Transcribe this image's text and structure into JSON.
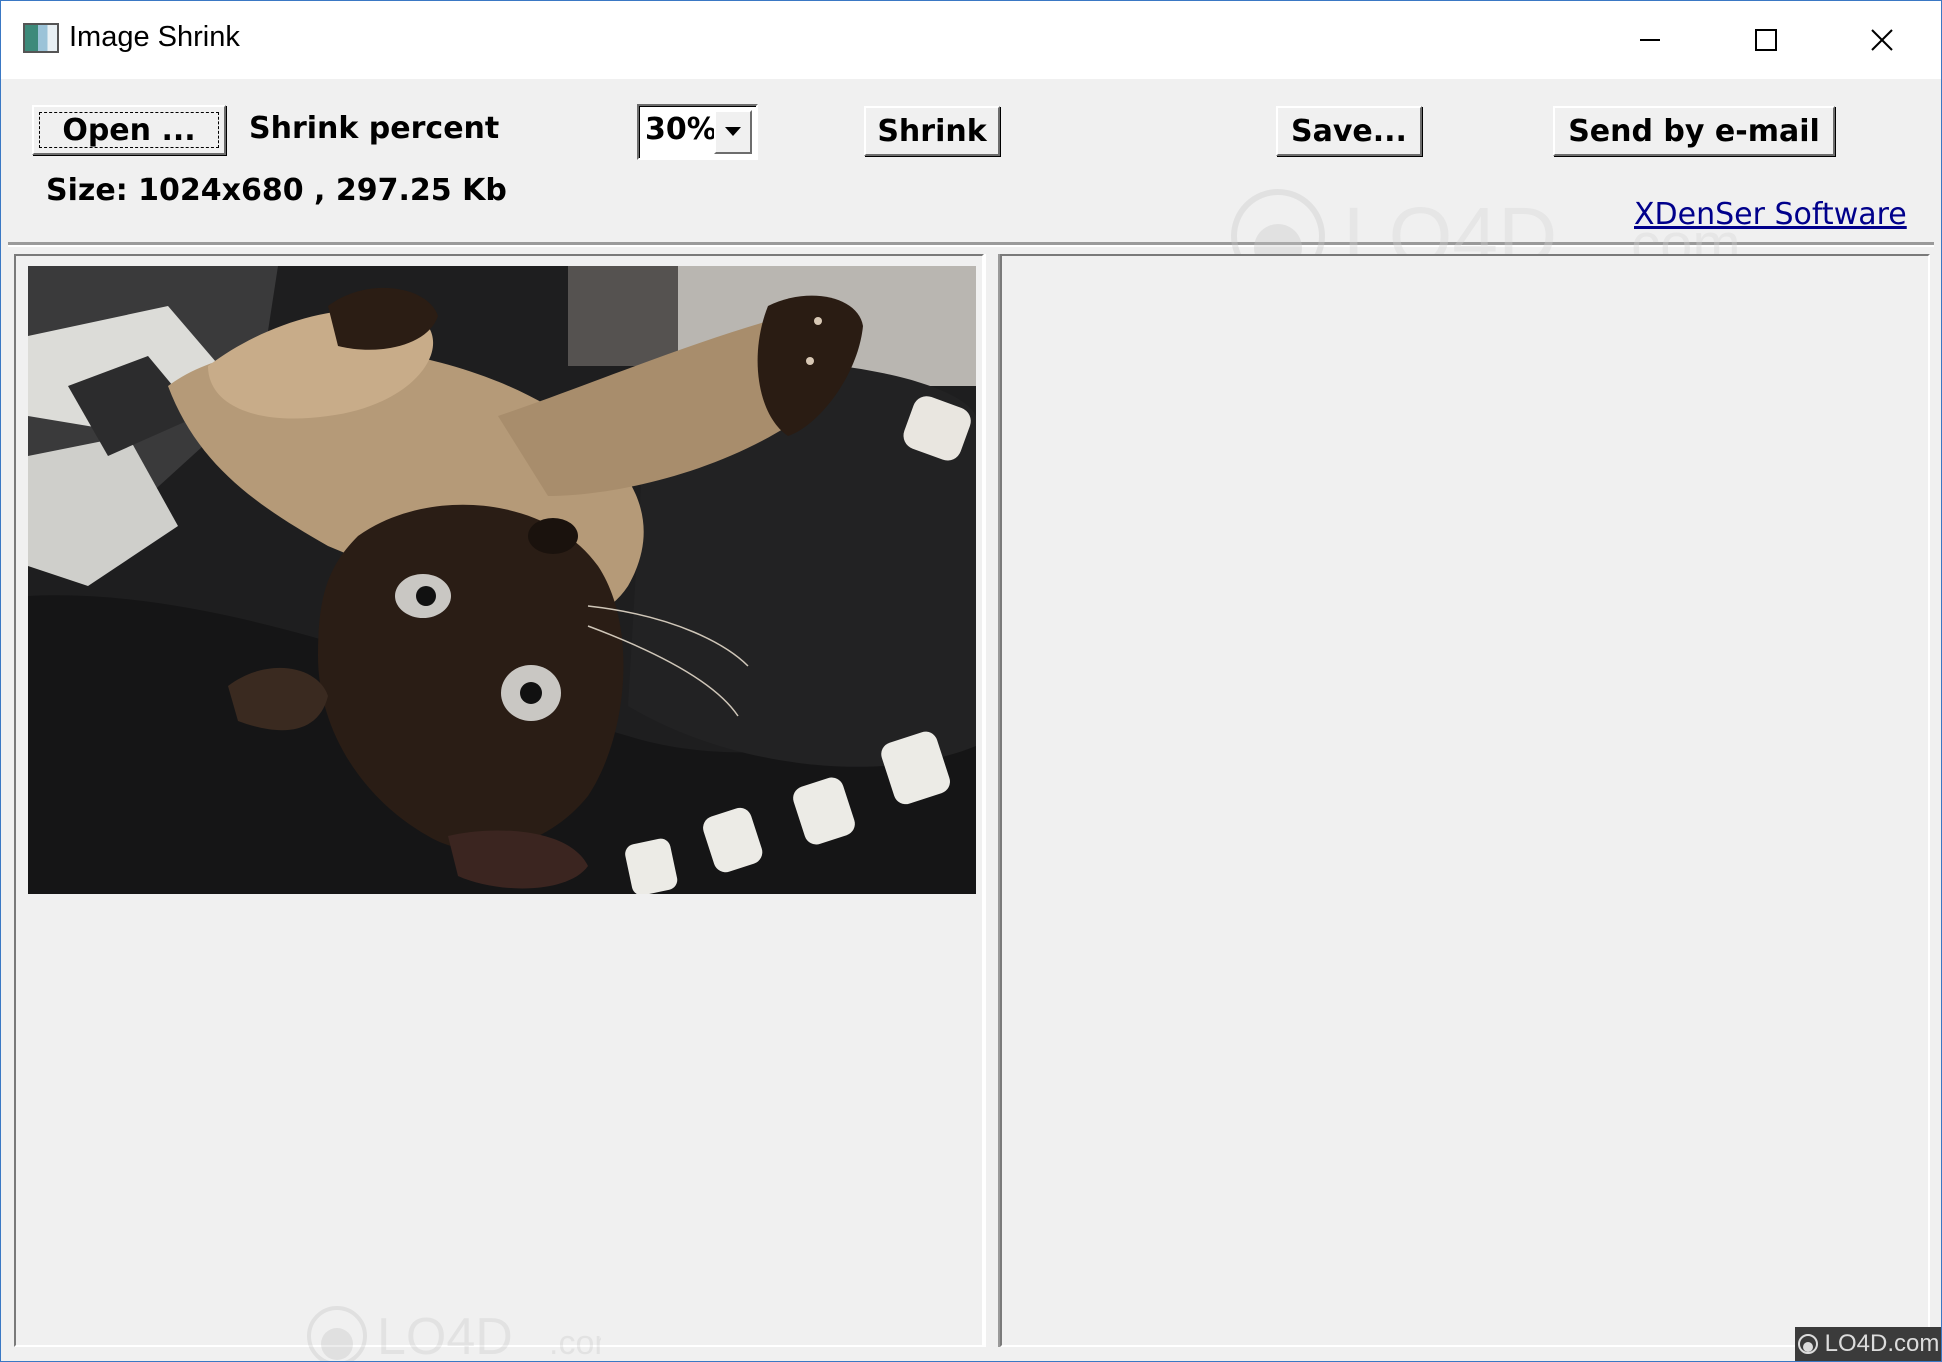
{
  "window": {
    "title": "Image Shrink",
    "minimize_icon": "minimize-icon",
    "maximize_icon": "maximize-icon",
    "close_icon": "close-icon"
  },
  "toolbar": {
    "open_label": "Open ...",
    "shrink_percent_label": "Shrink percent",
    "shrink_percent_value": "30%",
    "shrink_label": "Shrink",
    "save_label": "Save...",
    "send_label": "Send by e-mail",
    "size_text": "Size: 1024x680 , 297.25 Kb",
    "vendor_link": "XDenSer Software"
  },
  "watermark": {
    "text": "LO4D.com",
    "corner_text": "LO4D.com"
  },
  "colors": {
    "link": "#00008b",
    "face": "#f0f0f0",
    "window_border": "#3a78c4"
  }
}
